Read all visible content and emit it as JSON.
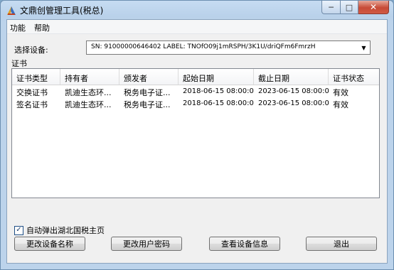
{
  "window": {
    "title": "文鼎创管理工具(税总)"
  },
  "menu": [
    "功能",
    "帮助"
  ],
  "device": {
    "label": "选择设备:",
    "selected": "SN: 91000000646402  LABEL: TNOfO09j1mRSPH/3K1U/driQFm6FmrzH"
  },
  "certs": {
    "group_label": "证书",
    "columns": [
      "证书类型",
      "持有者",
      "颁发者",
      "起始日期",
      "截止日期",
      "证书状态"
    ],
    "rows": [
      [
        "交换证书",
        "凯迪生态环...",
        "税务电子证...",
        "2018-06-15 08:00:00",
        "2023-06-15 08:00:00",
        "有效"
      ],
      [
        "签名证书",
        "凯迪生态环...",
        "税务电子证...",
        "2018-06-15 08:00:00",
        "2023-06-15 08:00:00",
        "有效"
      ]
    ]
  },
  "auto_popup": {
    "label": "自动弹出湖北国税主页",
    "checked": true
  },
  "buttons": {
    "rename": "更改设备名称",
    "change_pin": "更改用户密码",
    "view_info": "查看设备信息",
    "exit": "退出"
  }
}
